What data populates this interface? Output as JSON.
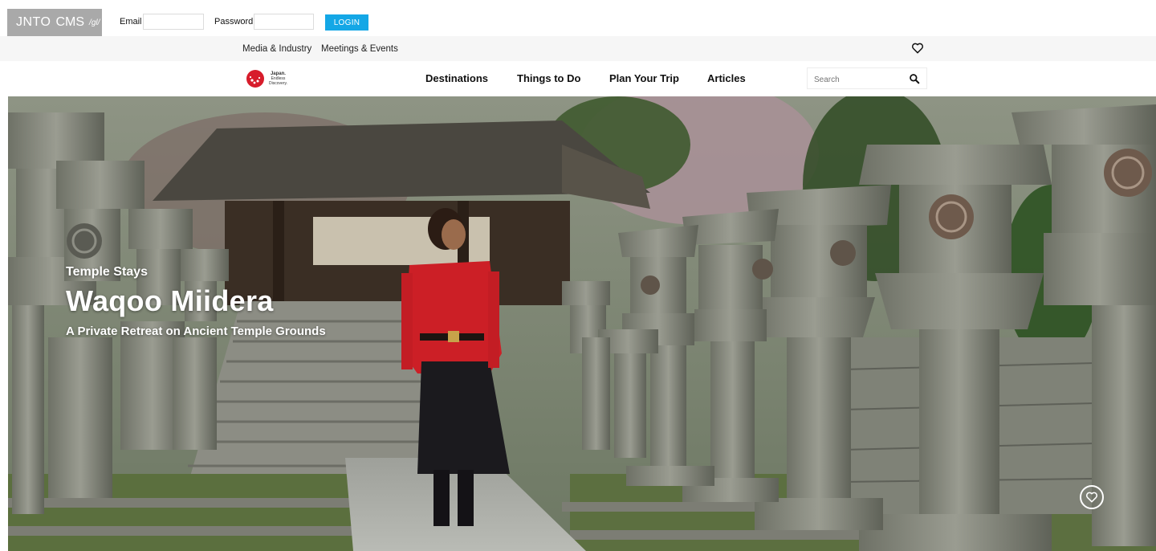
{
  "cms": {
    "logo_brand": "JNTO",
    "logo_cms": "CMS",
    "logo_lang": "/gl/",
    "email_label": "Email",
    "email_value": "",
    "password_label": "Password",
    "password_value": "",
    "login_label": "LOGIN"
  },
  "utility": {
    "links": [
      "Media & Industry",
      "Meetings & Events"
    ],
    "favorites_icon": "heart-icon"
  },
  "nav": {
    "logo_lines": [
      "Japan.",
      "Endless",
      "Discovery."
    ],
    "items": [
      "Destinations",
      "Things to Do",
      "Plan Your Trip",
      "Articles"
    ],
    "search_placeholder": "Search",
    "search_icon": "search-icon"
  },
  "hero": {
    "eyebrow": "Temple Stays",
    "title": "Waqoo Miidera",
    "subtitle": "A Private Retreat on Ancient Temple Grounds",
    "favorite_icon": "heart-circle-icon"
  },
  "colors": {
    "accent": "#14a7e6",
    "logo_bg": "#a9a9a9",
    "logo_red": "#d71c2b",
    "utility_bg": "#f6f6f6"
  }
}
